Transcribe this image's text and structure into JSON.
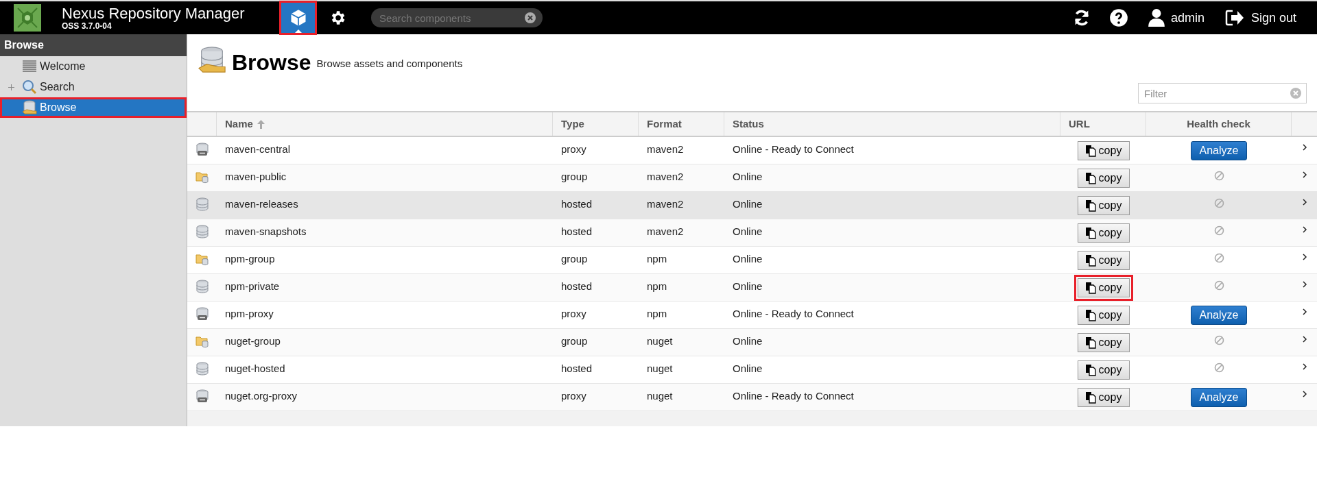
{
  "header": {
    "title": "Nexus Repository Manager",
    "version": "OSS 3.7.0-04",
    "modes": [
      {
        "kind": "browse",
        "selected": true,
        "highlighted": true
      },
      {
        "kind": "admin",
        "selected": false,
        "highlighted": false
      }
    ],
    "search": {
      "placeholder": "Search components"
    },
    "user": "admin",
    "sign_out": "Sign out"
  },
  "sidebar": {
    "title": "Browse",
    "items": [
      {
        "label": "Welcome",
        "kind": "welcome",
        "expandable": false,
        "selected": false,
        "highlighted": false
      },
      {
        "label": "Search",
        "kind": "search",
        "expandable": true,
        "selected": false,
        "highlighted": false
      },
      {
        "label": "Browse",
        "kind": "browse",
        "expandable": false,
        "selected": true,
        "highlighted": true
      }
    ]
  },
  "page": {
    "title": "Browse",
    "subtitle": "Browse assets and components",
    "filter": {
      "placeholder": "Filter"
    }
  },
  "table": {
    "columns": [
      "Name",
      "Type",
      "Format",
      "Status",
      "URL",
      "Health check"
    ],
    "rows": [
      {
        "kind": "proxy",
        "name": "maven-central",
        "type": "proxy",
        "format": "maven2",
        "status": "Online - Ready to Connect",
        "url": "copy",
        "url_highlighted": false,
        "health": {
          "kind": "button",
          "label": "Analyze"
        },
        "selected": false
      },
      {
        "kind": "group",
        "name": "maven-public",
        "type": "group",
        "format": "maven2",
        "status": "Online",
        "url": "copy",
        "url_highlighted": false,
        "health": {
          "kind": "unavailable"
        },
        "selected": false
      },
      {
        "kind": "hosted",
        "name": "maven-releases",
        "type": "hosted",
        "format": "maven2",
        "status": "Online",
        "url": "copy",
        "url_highlighted": false,
        "health": {
          "kind": "unavailable"
        },
        "selected": true
      },
      {
        "kind": "hosted",
        "name": "maven-snapshots",
        "type": "hosted",
        "format": "maven2",
        "status": "Online",
        "url": "copy",
        "url_highlighted": false,
        "health": {
          "kind": "unavailable"
        },
        "selected": false
      },
      {
        "kind": "group",
        "name": "npm-group",
        "type": "group",
        "format": "npm",
        "status": "Online",
        "url": "copy",
        "url_highlighted": false,
        "health": {
          "kind": "unavailable"
        },
        "selected": false
      },
      {
        "kind": "hosted",
        "name": "npm-private",
        "type": "hosted",
        "format": "npm",
        "status": "Online",
        "url": "copy",
        "url_highlighted": true,
        "health": {
          "kind": "unavailable"
        },
        "selected": false
      },
      {
        "kind": "proxy",
        "name": "npm-proxy",
        "type": "proxy",
        "format": "npm",
        "status": "Online - Ready to Connect",
        "url": "copy",
        "url_highlighted": false,
        "health": {
          "kind": "button",
          "label": "Analyze"
        },
        "selected": false
      },
      {
        "kind": "group",
        "name": "nuget-group",
        "type": "group",
        "format": "nuget",
        "status": "Online",
        "url": "copy",
        "url_highlighted": false,
        "health": {
          "kind": "unavailable"
        },
        "selected": false
      },
      {
        "kind": "hosted",
        "name": "nuget-hosted",
        "type": "hosted",
        "format": "nuget",
        "status": "Online",
        "url": "copy",
        "url_highlighted": false,
        "health": {
          "kind": "unavailable"
        },
        "selected": false
      },
      {
        "kind": "proxy",
        "name": "nuget.org-proxy",
        "type": "proxy",
        "format": "nuget",
        "status": "Online - Ready to Connect",
        "url": "copy",
        "url_highlighted": false,
        "health": {
          "kind": "button",
          "label": "Analyze"
        },
        "selected": false
      }
    ]
  }
}
